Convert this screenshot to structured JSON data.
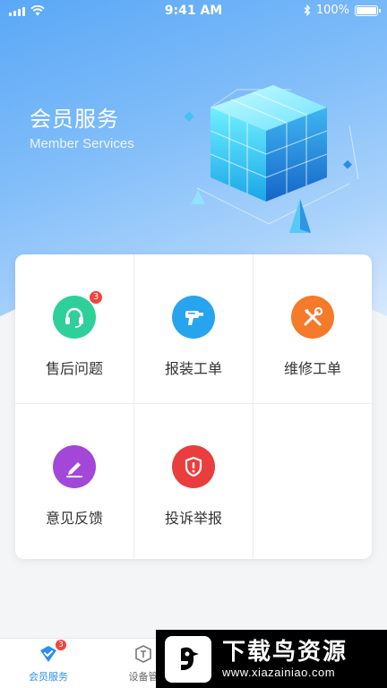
{
  "status_bar": {
    "time": "9:41 AM",
    "battery": "100%",
    "battery_level": 1.0
  },
  "hero": {
    "title": "会员服务",
    "subtitle": "Member Services"
  },
  "services": [
    {
      "label": "售后问题",
      "icon": "headset-icon",
      "color": "#2fcf9a",
      "badge": "3"
    },
    {
      "label": "报装工单",
      "icon": "drill-icon",
      "color": "#27a4ee",
      "badge": ""
    },
    {
      "label": "维修工单",
      "icon": "tools-icon",
      "color": "#f57a2a",
      "badge": ""
    },
    {
      "label": "意见反馈",
      "icon": "edit-icon",
      "color": "#a347d8",
      "badge": ""
    },
    {
      "label": "投诉举报",
      "icon": "shield-alert-icon",
      "color": "#ea3d3d",
      "badge": ""
    }
  ],
  "tab_bar": {
    "tabs": [
      {
        "label": "会员服务",
        "icon": "checkmark-diamond-icon",
        "badge": "3",
        "active": true
      },
      {
        "label": "设备管",
        "icon": "device-box-icon",
        "active": false
      }
    ],
    "active_color": "#2b8ff0",
    "inactive_color": "#666666"
  },
  "watermark": {
    "title": "下载鸟资源",
    "url": "www.xiazainiao.com"
  }
}
